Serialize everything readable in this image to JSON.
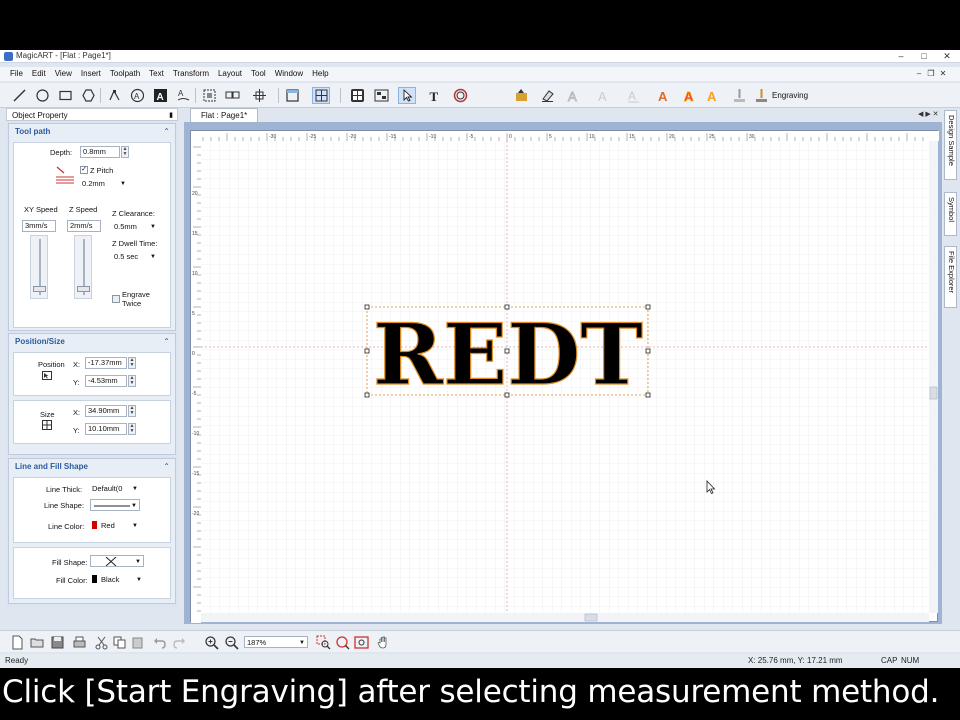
{
  "window": {
    "title": "MagicART - [Flat : Page1*]"
  },
  "menu": [
    "File",
    "Edit",
    "View",
    "Insert",
    "Toolpath",
    "Text",
    "Transform",
    "Layout",
    "Tool",
    "Window",
    "Help"
  ],
  "toolbar": {
    "engraving_label": "Engraving"
  },
  "object_property": {
    "header": "Object Property",
    "tool_path": {
      "title": "Tool path",
      "depth_label": "Depth:",
      "depth_value": "0.8mm",
      "z_pitch_label": "Z Pitch",
      "z_pitch_value": "0.2mm",
      "xy_speed_label": "XY Speed",
      "xy_speed_value": "3mm/s",
      "z_speed_label": "Z Speed",
      "z_speed_value": "2mm/s",
      "z_clearance_label": "Z Clearance:",
      "z_clearance_value": "0.5mm",
      "z_dwell_label": "Z Dwell Time:",
      "z_dwell_value": "0.5 sec",
      "engrave_twice_line1": "Engrave",
      "engrave_twice_line2": "Twice"
    },
    "position_size": {
      "title": "Position/Size",
      "position_label": "Position",
      "size_label": "Size",
      "x_label": "X:",
      "y_label": "Y:",
      "pos_x": "-17.37mm",
      "pos_y": "-4.53mm",
      "size_x": "34.90mm",
      "size_y": "10.10mm"
    },
    "line_fill": {
      "title": "Line and Fill Shape",
      "line_thick_label": "Line Thick:",
      "line_thick_value": "Default(0",
      "line_shape_label": "Line Shape:",
      "line_color_label": "Line Color:",
      "line_color_value": "Red",
      "line_color_hex": "#d40000",
      "fill_shape_label": "Fill Shape:",
      "fill_color_label": "Fill Color:",
      "fill_color_value": "Black",
      "fill_color_hex": "#000000"
    }
  },
  "document": {
    "tab_label": "Flat : Page1*",
    "canvas_text": "REDT",
    "ruler_top": [
      "-30",
      "-25",
      "-20",
      "-15",
      "-10",
      "-5",
      "0",
      "5",
      "10",
      "15",
      "20",
      "25",
      "30"
    ],
    "ruler_left": [
      "20",
      "15",
      "10",
      "5",
      "0",
      "-5",
      "-10",
      "-15",
      "-20"
    ]
  },
  "side_tabs": [
    "Design Sample",
    "Symbol",
    "File Explorer"
  ],
  "bottom_toolbar": {
    "zoom_value": "187%"
  },
  "status": {
    "ready": "Ready",
    "coords": "X: 25.76 mm,  Y: 17.21 mm",
    "cap": "CAP",
    "num": "NUM"
  },
  "caption": "Click [Start Engraving] after selecting measurement method."
}
